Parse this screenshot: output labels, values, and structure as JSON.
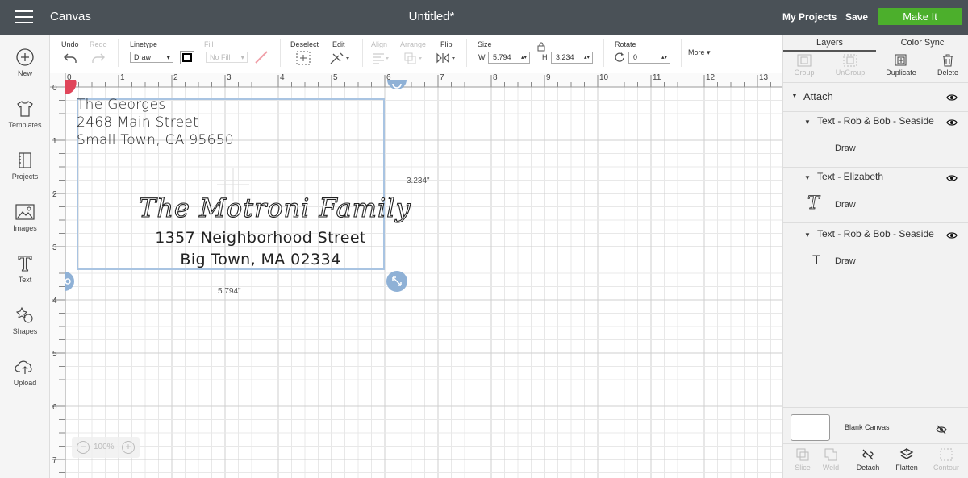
{
  "topbar": {
    "app_title": "Canvas",
    "doc_title": "Untitled*",
    "my_projects": "My Projects",
    "save": "Save",
    "make_it": "Make It"
  },
  "leftbar": {
    "items": [
      {
        "label": "New"
      },
      {
        "label": "Templates"
      },
      {
        "label": "Projects"
      },
      {
        "label": "Images"
      },
      {
        "label": "Text"
      },
      {
        "label": "Shapes"
      },
      {
        "label": "Upload"
      }
    ]
  },
  "toolbar": {
    "undo": "Undo",
    "redo": "Redo",
    "linetype": "Linetype",
    "linetype_value": "Draw",
    "fill": "Fill",
    "fill_value": "No Fill",
    "deselect": "Deselect",
    "edit": "Edit",
    "align": "Align",
    "arrange": "Arrange",
    "flip": "Flip",
    "size": "Size",
    "w_label": "W",
    "w_value": "5.794",
    "h_label": "H",
    "h_value": "3.234",
    "rotate": "Rotate",
    "rotate_value": "0",
    "more": "More"
  },
  "canvas": {
    "ruler_x": [
      "0",
      "1",
      "2",
      "3",
      "4",
      "5",
      "6",
      "7",
      "8",
      "9",
      "10",
      "11",
      "12",
      "13"
    ],
    "ruler_y": [
      "0",
      "1",
      "2",
      "3",
      "4",
      "5",
      "6",
      "7"
    ],
    "return_lines": [
      "The Georges",
      "2468 Main Street",
      "Small Town, CA 95650"
    ],
    "recipient_name": "The Motroni Family",
    "recipient_lines": [
      "1357 Neighborhood Street",
      "Big Town, MA 02334"
    ],
    "height_dim": "3.234\"",
    "width_dim": "5.794\"",
    "zoom": "100%"
  },
  "rightpanel": {
    "tabs": [
      "Layers",
      "Color Sync"
    ],
    "tools": [
      {
        "label": "Group",
        "enabled": false
      },
      {
        "label": "UnGroup",
        "enabled": false
      },
      {
        "label": "Duplicate",
        "enabled": true
      },
      {
        "label": "Delete",
        "enabled": true
      }
    ],
    "attach": "Attach",
    "layers": [
      {
        "title": "Text - Rob & Bob - Seaside",
        "sub": "Draw"
      },
      {
        "title": "Text - Elizabeth",
        "sub": "Draw"
      },
      {
        "title": "Text - Rob & Bob - Seaside",
        "sub": "Draw"
      }
    ],
    "blank_canvas": "Blank Canvas",
    "bottom_tools": [
      {
        "label": "Slice",
        "enabled": false
      },
      {
        "label": "Weld",
        "enabled": false
      },
      {
        "label": "Detach",
        "enabled": true
      },
      {
        "label": "Flatten",
        "enabled": true
      },
      {
        "label": "Contour",
        "enabled": false
      }
    ]
  },
  "colors": {
    "topbar": "#4a5157",
    "make_it": "#4caf2c",
    "selection": "#8fb1d6",
    "handle_red": "#e0455a"
  }
}
